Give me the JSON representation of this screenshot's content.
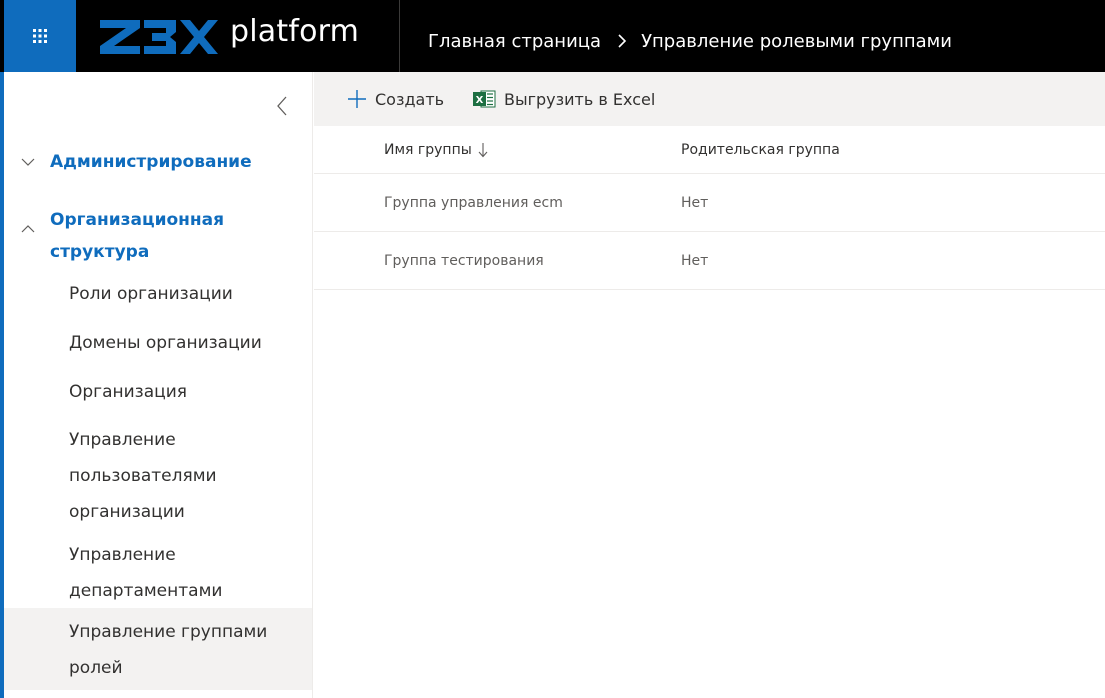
{
  "header": {
    "waffle_icon": "app-launcher-icon",
    "logo_text": "platform",
    "breadcrumb": [
      "Главная страница",
      "Управление ролевыми группами"
    ],
    "background_color": "#000000",
    "accent_color": "#0f6cbd"
  },
  "sidebar": {
    "sections": [
      {
        "label": "Администрирование",
        "expanded": false
      },
      {
        "label_line1": "Организационная",
        "label_line2": "структура",
        "expanded": true
      }
    ],
    "items": [
      {
        "lines": [
          "Роли организации"
        ]
      },
      {
        "lines": [
          "Домены организации"
        ]
      },
      {
        "lines": [
          "Организация"
        ]
      },
      {
        "lines": [
          "Управление",
          "пользователями",
          "организации"
        ]
      },
      {
        "lines": [
          "Управление",
          "департаментами"
        ]
      },
      {
        "lines": [
          "Управление группами",
          "ролей"
        ],
        "selected": true
      }
    ]
  },
  "commandbar": {
    "create_label": "Создать",
    "export_label": "Выгрузить в Excel"
  },
  "table": {
    "columns": [
      "Имя группы",
      "Родительская группа"
    ],
    "sorted_column": "Имя группы",
    "rows": [
      [
        "Группа управления ecm",
        "Нет"
      ],
      [
        "Группа тестирования",
        "Нет"
      ]
    ]
  }
}
